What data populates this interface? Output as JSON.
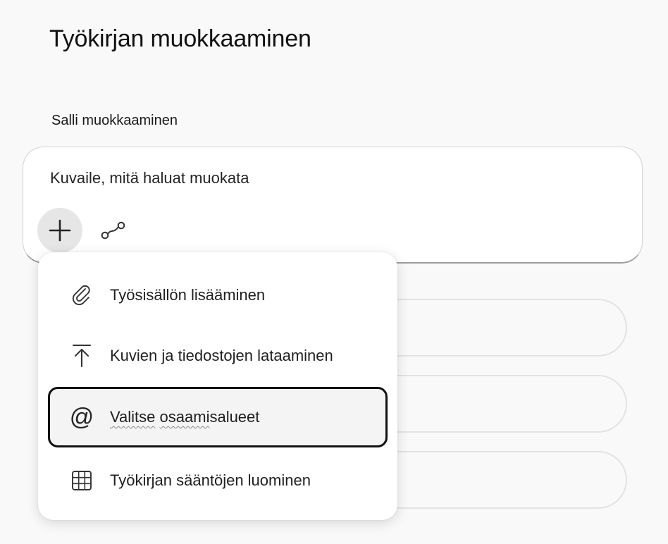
{
  "page": {
    "title": "Työkirjan muokkaaminen",
    "section_label": "Salli muokkaaminen"
  },
  "composer": {
    "placeholder": "Kuvaile, mitä haluat muokata",
    "add_icon": "plus-icon",
    "link_icon": "connect-icon"
  },
  "menu": {
    "items": [
      {
        "label": "Työsisällön lisääminen",
        "icon": "paperclip-icon"
      },
      {
        "label": "Kuvien ja tiedostojen lataaminen",
        "icon": "upload-icon"
      },
      {
        "label_parts": [
          "Valitse",
          " ",
          "osaami",
          "salueet"
        ],
        "icon": "at-sign-icon",
        "focused": true
      },
      {
        "label": "Työkirjan sääntöjen luominen",
        "icon": "table-icon"
      }
    ]
  },
  "colors": {
    "background": "#f9f9f9",
    "surface": "#ffffff",
    "focus_ring": "#111111"
  }
}
